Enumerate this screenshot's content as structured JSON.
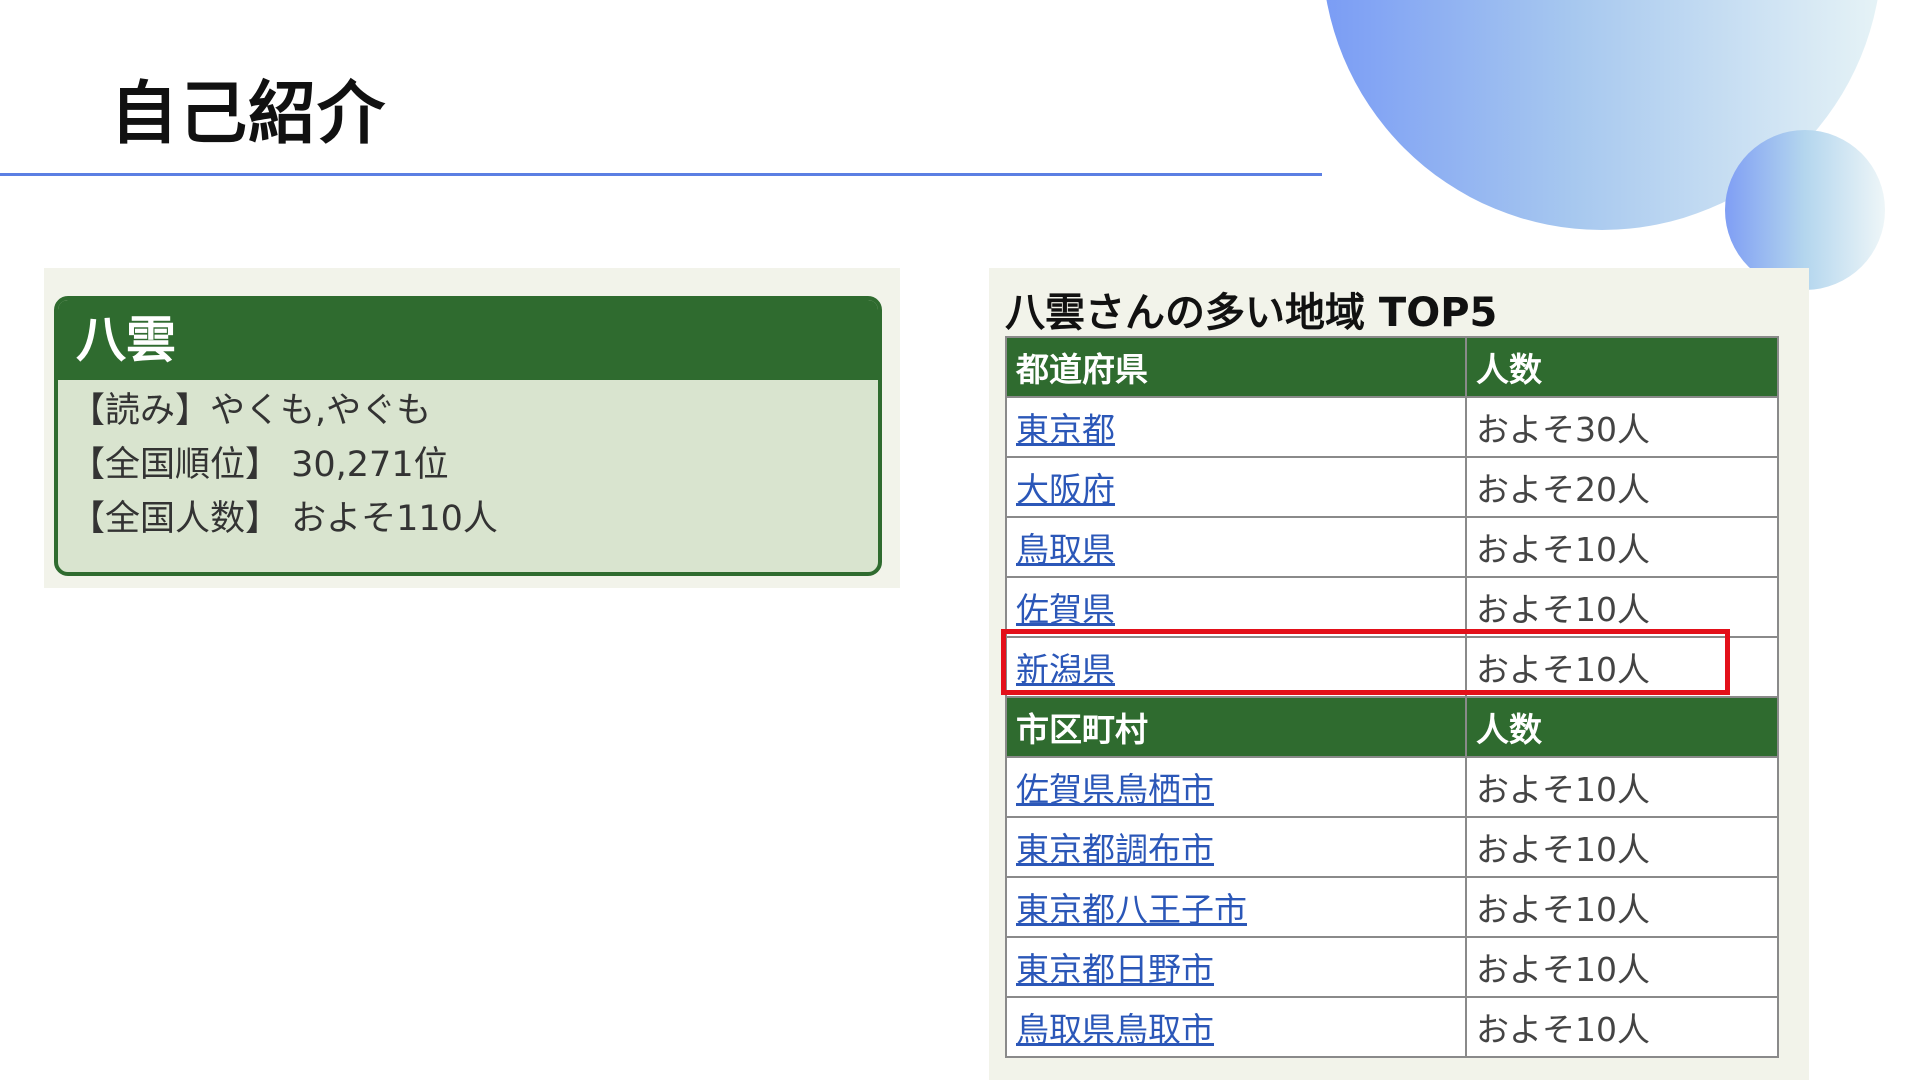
{
  "slide": {
    "title": "自己紹介"
  },
  "name_card": {
    "surname": "八雲",
    "reading_line": "【読み】やくも,やぐも",
    "rank_line": "【全国順位】 30,271位",
    "population_line": "【全国人数】 およそ110人"
  },
  "ranking": {
    "title": "八雲さんの多い地域 TOP5",
    "prefecture_header": "都道府県",
    "prefecture_count_header": "人数",
    "prefectures": [
      {
        "name": "東京都",
        "count": "およそ30人"
      },
      {
        "name": "大阪府",
        "count": "およそ20人"
      },
      {
        "name": "鳥取県",
        "count": "およそ10人"
      },
      {
        "name": "佐賀県",
        "count": "およそ10人"
      },
      {
        "name": "新潟県",
        "count": "およそ10人"
      }
    ],
    "city_header": "市区町村",
    "city_count_header": "人数",
    "cities": [
      {
        "name": "佐賀県鳥栖市",
        "count": "およそ10人"
      },
      {
        "name": "東京都調布市",
        "count": "およそ10人"
      },
      {
        "name": "東京都八王子市",
        "count": "およそ10人"
      },
      {
        "name": "東京都日野市",
        "count": "およそ10人"
      },
      {
        "name": "鳥取県鳥取市",
        "count": "およそ10人"
      }
    ],
    "highlighted_prefecture": "新潟県"
  },
  "colors": {
    "header_green": "#2f6b2f",
    "card_fill": "#d9e4cf",
    "panel_bg": "#f2f3ea",
    "link_blue": "#2b57b8",
    "accent_line": "#5b7fe3",
    "highlight_red": "#e3101a"
  }
}
